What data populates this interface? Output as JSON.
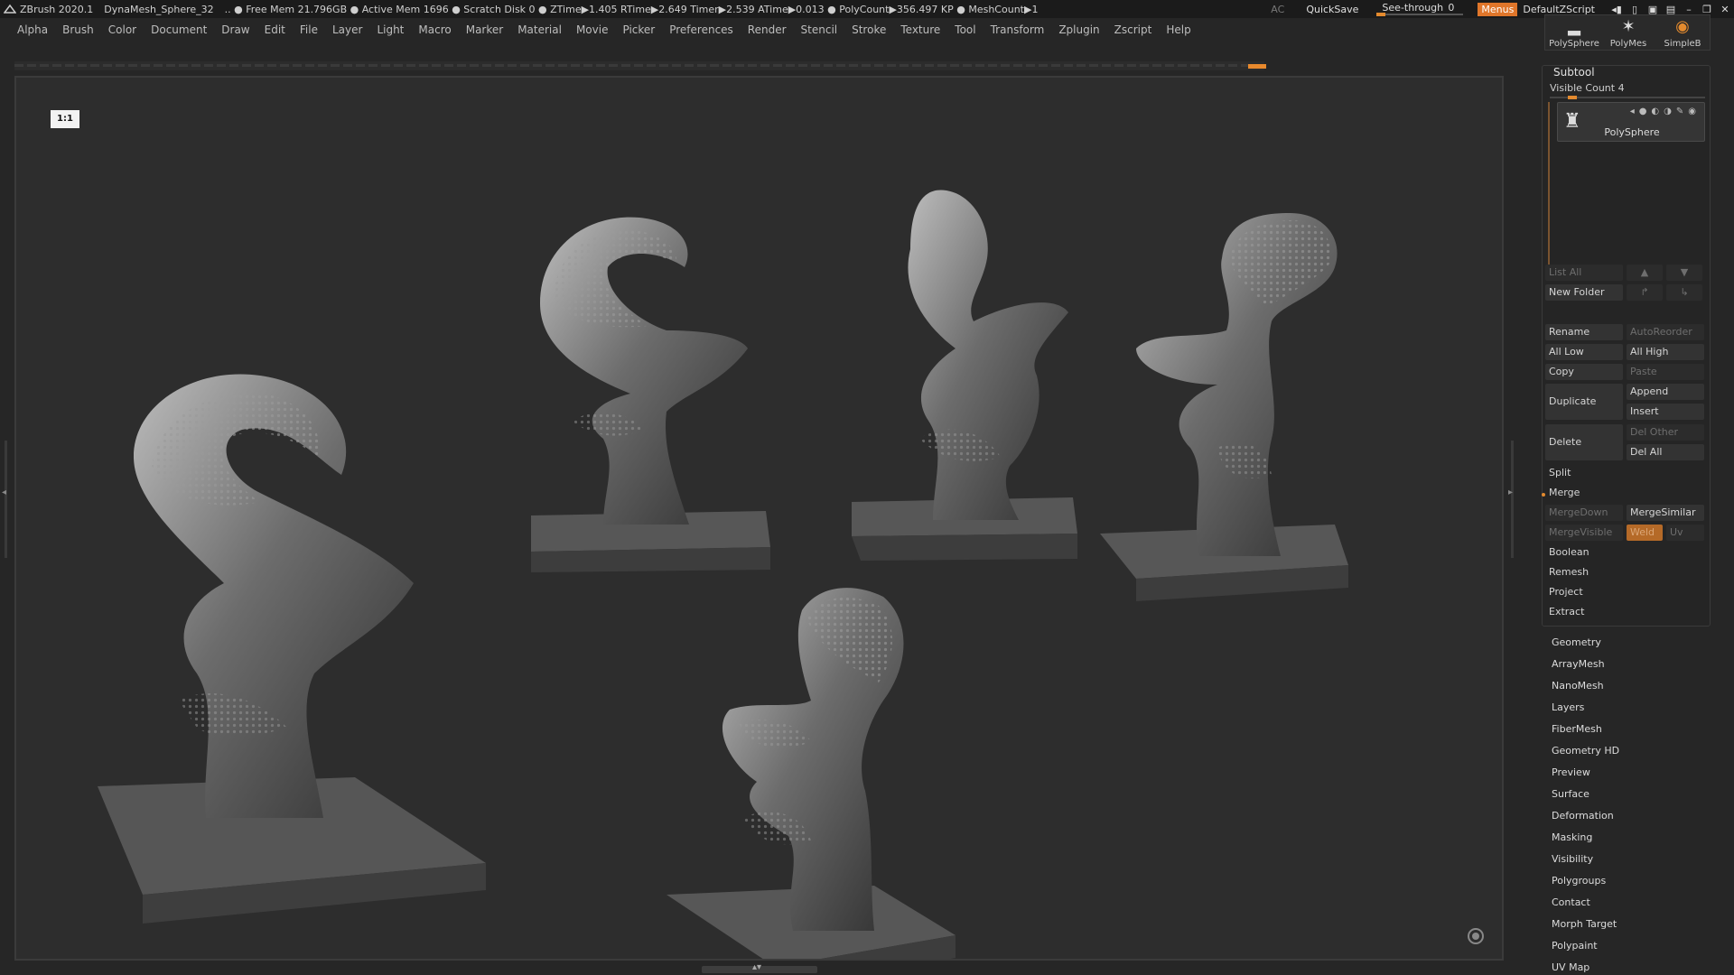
{
  "titlebar": {
    "app_name": "ZBrush 2020.1",
    "file": "DynaMesh_Sphere_32",
    "stats": ".. ● Free Mem 21.796GB ● Active Mem 1696 ● Scratch Disk 0 ●  ZTime▶1.405 RTime▶2.649 Timer▶2.539 ATime▶0.013 ● PolyCount▶356.497 KP ● MeshCount▶1",
    "ac": "AC",
    "quicksave": "QuickSave",
    "see_through_label": "See-through",
    "see_through_value": "0",
    "menus": "Menus",
    "default_zscript": "DefaultZScript"
  },
  "menubar": [
    "Alpha",
    "Brush",
    "Color",
    "Document",
    "Draw",
    "Edit",
    "File",
    "Layer",
    "Light",
    "Macro",
    "Marker",
    "Material",
    "Movie",
    "Picker",
    "Preferences",
    "Render",
    "Stencil",
    "Stroke",
    "Texture",
    "Tool",
    "Transform",
    "Zplugin",
    "Zscript",
    "Help"
  ],
  "canvas": {
    "camera_icon_text": "1:1"
  },
  "top_tools": [
    {
      "label": "PolySphere",
      "icon": "polysphere-icon"
    },
    {
      "label": "PolyMes",
      "icon": "star-icon"
    },
    {
      "label": "SimpleB",
      "icon": "simplebrush-icon"
    }
  ],
  "subtool": {
    "title": "Subtool",
    "visible_count": "Visible Count 4",
    "item_name": "PolySphere",
    "list_all": "List All",
    "new_folder": "New Folder",
    "rename": "Rename",
    "auto_reorder": "AutoReorder",
    "all_low": "All Low",
    "all_high": "All High",
    "copy": "Copy",
    "paste": "Paste",
    "duplicate": "Duplicate",
    "append": "Append",
    "insert": "Insert",
    "delete": "Delete",
    "del_other": "Del Other",
    "del_all": "Del All",
    "split": "Split",
    "merge": "Merge",
    "merge_down": "MergeDown",
    "merge_similar": "MergeSimilar",
    "merge_visible": "MergeVisible",
    "weld": "Weld",
    "uv": "Uv",
    "boolean": "Boolean",
    "remesh": "Remesh",
    "project": "Project",
    "extract": "Extract"
  },
  "sections": [
    "Geometry",
    "ArrayMesh",
    "NanoMesh",
    "Layers",
    "FiberMesh",
    "Geometry HD",
    "Preview",
    "Surface",
    "Deformation",
    "Masking",
    "Visibility",
    "Polygroups",
    "Contact",
    "Morph Target",
    "Polypaint",
    "UV Map"
  ]
}
